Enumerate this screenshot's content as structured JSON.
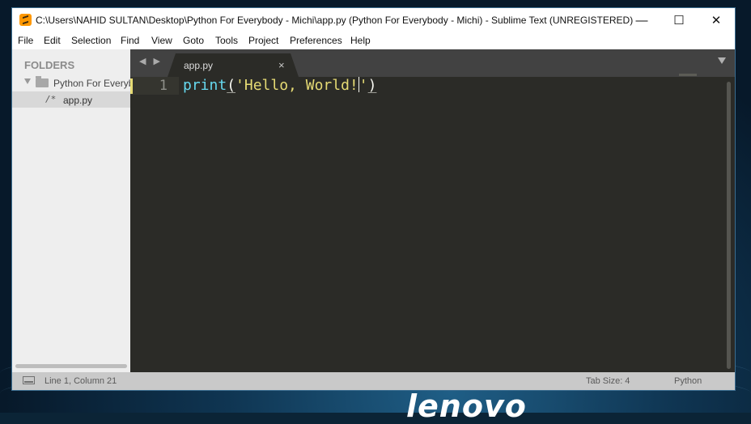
{
  "window": {
    "title": "C:\\Users\\NAHID SULTAN\\Desktop\\Python For Everybody - Michi\\app.py (Python For Everybody - Michi) - Sublime Text (UNREGISTERED)",
    "controls": {
      "minimize": "—",
      "maximize": "☐",
      "close": "✕"
    }
  },
  "menu": [
    "File",
    "Edit",
    "Selection",
    "Find",
    "View",
    "Goto",
    "Tools",
    "Project",
    "Preferences",
    "Help"
  ],
  "sidebar": {
    "header": "FOLDERS",
    "folder": "Python For Everybody - Michi",
    "file_icon": "/*",
    "file": "app.py"
  },
  "tabs": {
    "nav": "◀ ▶",
    "active": "app.py",
    "close": "×"
  },
  "editor": {
    "line_number": "1",
    "tokens": {
      "fn": "print",
      "open": "(",
      "str_before_cursor": "'Hello, World!",
      "str_after_cursor": "'",
      "close": ")"
    }
  },
  "status": {
    "position": "Line 1, Column 21",
    "tab_size": "Tab Size: 4",
    "syntax": "Python"
  },
  "desktop": {
    "logo": "lenovo"
  },
  "colors": {
    "editor_bg": "#2b2b27",
    "function": "#66d9ef",
    "string": "#e6db74",
    "sidebar_bg": "#eeeeee",
    "tabbar_bg": "#424242",
    "statusbar_bg": "#c9c9c9"
  }
}
